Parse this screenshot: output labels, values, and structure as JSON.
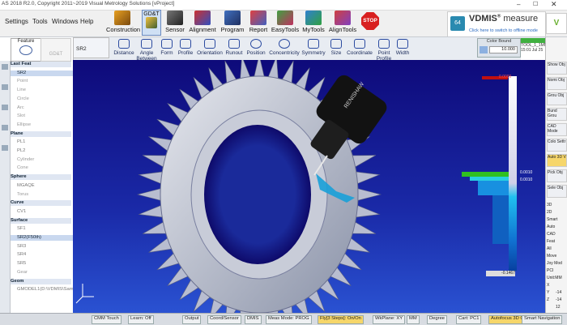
{
  "title": "AS 2018 R2.0, Copyright 2011~2019   Visual Metrology Solutions [vProject]",
  "menu": [
    "Settings",
    "Tools",
    "Windows",
    "Help"
  ],
  "ribbon": [
    "Construction",
    "GD&T",
    "Sensor",
    "Alignment",
    "Program",
    "Report",
    "EasyTools",
    "MyTools",
    "AlignTools",
    "STOP"
  ],
  "vdmis": {
    "title": "VDMIS",
    "reg": "®",
    "word": "measure",
    "subtitle": "Click here to switch to offline mode",
    "badge": "64"
  },
  "meas_tools": [
    "Distance",
    "Angle Between",
    "Form",
    "Profile",
    "Orientation",
    "Runout",
    "Position",
    "Concentricity",
    "Symmetry",
    "Size",
    "Coordinate",
    "Point Profile",
    "Width"
  ],
  "tabs": {
    "feature": "Feature",
    "gdt": "GD&T"
  },
  "viewport_label": "SR2",
  "color_bound": {
    "title": "Color Bound",
    "value": "10.000"
  },
  "right_readout": {
    "top": "30.0°",
    "line1": "TOOL_1_1MM_1_40_2_40",
    "line2": "15:01 Jul 25"
  },
  "tree": [
    {
      "label": "Last Feat",
      "type": "grp"
    },
    {
      "label": "SR2",
      "type": "sel"
    },
    {
      "label": "Point",
      "type": "grp2"
    },
    {
      "label": "Line",
      "type": "grp2"
    },
    {
      "label": "Circle",
      "type": "grp2"
    },
    {
      "label": "Arc",
      "type": "grp2"
    },
    {
      "label": "Slot",
      "type": "grp2"
    },
    {
      "label": "Ellipse",
      "type": "grp2"
    },
    {
      "label": "Plane",
      "type": "grp"
    },
    {
      "label": "PL1",
      "type": "sub"
    },
    {
      "label": "PL2",
      "type": "sub"
    },
    {
      "label": "Cylinder",
      "type": "grp2"
    },
    {
      "label": "Cone",
      "type": "grp2"
    },
    {
      "label": "Sphere",
      "type": "grp"
    },
    {
      "label": "MGAQE",
      "type": "sub"
    },
    {
      "label": "Torus",
      "type": "grp2"
    },
    {
      "label": "Curve",
      "type": "grp"
    },
    {
      "label": "CV1",
      "type": "sub"
    },
    {
      "label": "Surface",
      "type": "grp"
    },
    {
      "label": "SF1",
      "type": "sub"
    },
    {
      "label": "SR2(F50th)",
      "type": "sel"
    },
    {
      "label": "SR3",
      "type": "sub"
    },
    {
      "label": "SR4",
      "type": "sub"
    },
    {
      "label": "SR5",
      "type": "sub"
    },
    {
      "label": "Gear",
      "type": "grp2"
    },
    {
      "label": "Geom",
      "type": "grp"
    },
    {
      "label": "GMODEL1(D:\\VDMIS\\Sam",
      "type": "sub"
    }
  ],
  "probe_label": "RENISHAW",
  "scale": {
    "top": "0.0000",
    "mid1": "0.0010",
    "mid2": "0.0010",
    "bottom": "-0.1467"
  },
  "right_items": [
    "Show Obj",
    "Nomi Obj",
    "Grou Obj",
    "Bund Grou",
    "CAD Mode",
    "Colo Settr",
    "Auto 3D V",
    "Pick Obj",
    "Sele Obj"
  ],
  "right_small": [
    "3D",
    "2D",
    "Smart",
    "Auto",
    "CAD",
    "Feat",
    "All",
    "Move",
    "Joy Mod",
    "PCI",
    "Unit:MM",
    "X",
    "Y",
    "Z"
  ],
  "right_values": [
    "-14",
    "-14",
    "12"
  ],
  "status": [
    "CMM Touch",
    "Learn: Off",
    "Output",
    "Coord/Sensor",
    "DMIS",
    "Meas Mode: PROG",
    "Fly[3 Steps]: On/On",
    "WkPlane: XY",
    "MM",
    "Degree",
    "Cart: PC1",
    "Autofocus 3D GUI",
    "Smart Navigation"
  ],
  "colors": {
    "bg_top": "#0e0a7a",
    "bg_bottom": "#2a52d2",
    "status_hl": "#f6d66a"
  }
}
